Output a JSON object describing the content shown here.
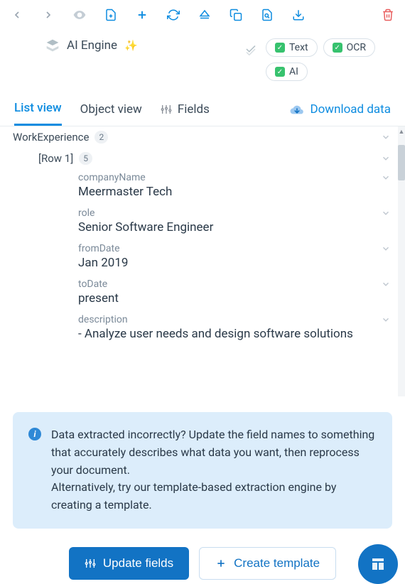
{
  "engine": {
    "label": "AI Engine"
  },
  "badges": {
    "text": "Text",
    "ocr": "OCR",
    "ai": "AI"
  },
  "tabs": {
    "list": "List view",
    "object": "Object view",
    "fields": "Fields"
  },
  "download_label": "Download data",
  "data": {
    "group_name": "WorkExperience",
    "group_count": "2",
    "row_label": "[Row 1]",
    "row_count": "5",
    "fields": {
      "companyName": {
        "label": "companyName",
        "value": "Meermaster Tech"
      },
      "role": {
        "label": "role",
        "value": "Senior Software Engineer"
      },
      "fromDate": {
        "label": "fromDate",
        "value": "Jan 2019"
      },
      "toDate": {
        "label": "toDate",
        "value": "present"
      },
      "description": {
        "label": "description",
        "value": "- Analyze user needs and design software solutions"
      }
    }
  },
  "info": {
    "line1": "Data extracted incorrectly? Update the field names to something that accurately describes what data you want, then reprocess your document.",
    "line2": "Alternatively, try our template-based extraction engine by creating a template."
  },
  "actions": {
    "update": "Update fields",
    "create": "Create template"
  }
}
